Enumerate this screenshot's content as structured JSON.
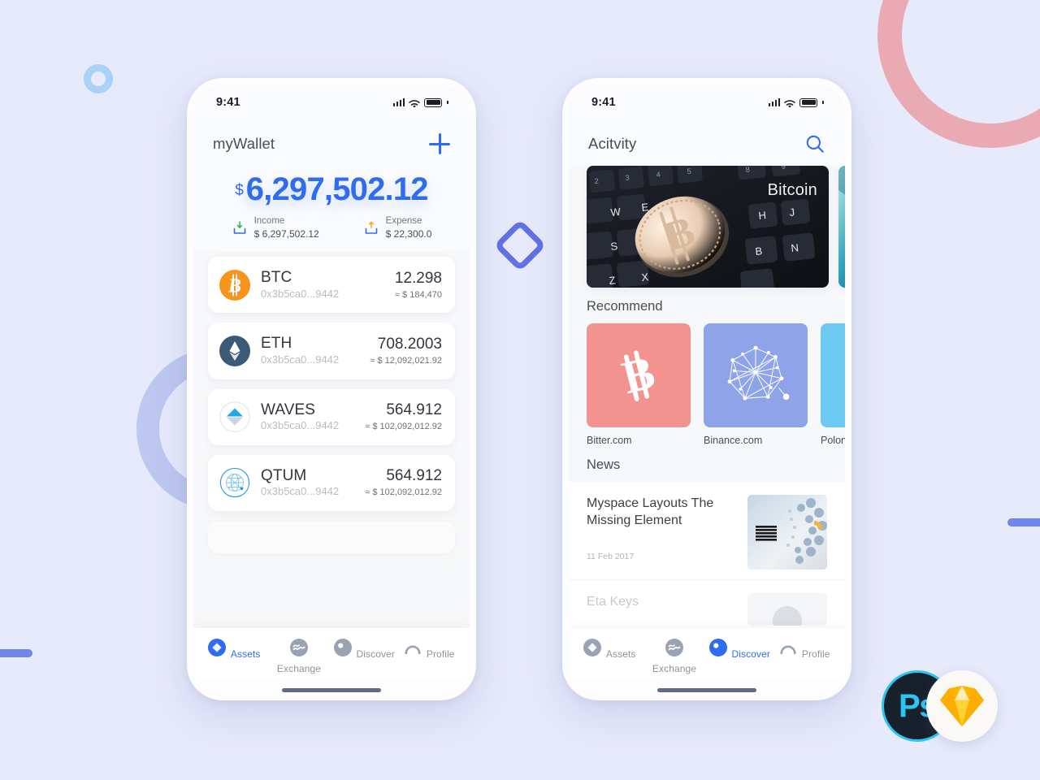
{
  "background": {
    "color": "#e7eafb",
    "decorations": [
      {
        "name": "pink-ring-arc",
        "color": "#e9a7b0"
      },
      {
        "name": "periwinkle-ring-arc",
        "color": "#b9c4ee"
      },
      {
        "name": "blue-ring",
        "color": "#a8d2f7"
      },
      {
        "name": "blue-bar-left",
        "color": "#6f86ea"
      },
      {
        "name": "blue-bar-right",
        "color": "#6f86ea"
      },
      {
        "name": "blue-diamond-outline",
        "color": "#6272e3"
      }
    ]
  },
  "accent": {
    "blue": "#2f6cf0",
    "muted": "#8e939c",
    "card": "#ffffff",
    "screen": "#f7f8f9"
  },
  "status_bar": {
    "time": "9:41",
    "signal_icon": "cellular-signal-icon",
    "wifi_icon": "wifi-icon",
    "battery_icon": "battery-full-icon"
  },
  "wallet": {
    "header": {
      "title": "myWallet",
      "add_icon": "plus-icon"
    },
    "balance": {
      "currency_symbol": "$",
      "amount": "6,297,502.12"
    },
    "summary": [
      {
        "icon": "income-download-icon",
        "label": "Income",
        "value": "$ 6,297,502.12"
      },
      {
        "icon": "expense-upload-icon",
        "label": "Expense",
        "value": "$ 22,300.0"
      }
    ],
    "assets": [
      {
        "icon": "bitcoin-coin-icon",
        "symbol": "BTC",
        "address": "0x3b5ca0...9442",
        "amount": "12.298",
        "fiat": "≈ $ 184,470",
        "color": "#f7941e"
      },
      {
        "icon": "ethereum-coin-icon",
        "symbol": "ETH",
        "address": "0x3b5ca0...9442",
        "amount": "708.2003",
        "fiat": "≈ $ 12,092,021.92",
        "color": "#3c5a78"
      },
      {
        "icon": "waves-coin-icon",
        "symbol": "WAVES",
        "address": "0x3b5ca0...9442",
        "amount": "564.912",
        "fiat": "≈ $ 102,092,012.92",
        "color": "#1eabdd"
      },
      {
        "icon": "qtum-coin-icon",
        "symbol": "QTUM",
        "address": "0x3b5ca0...9442",
        "amount": "564.912",
        "fiat": "≈ $ 102,092,012.92",
        "color": "#2e9ad0"
      }
    ],
    "tabs": [
      {
        "icon": "assets-diamond-icon",
        "label": "Assets",
        "active": true
      },
      {
        "icon": "exchange-waves-icon",
        "label": "Exchange",
        "active": false
      },
      {
        "icon": "discover-compass-icon",
        "label": "Discover",
        "active": false
      },
      {
        "icon": "profile-person-icon",
        "label": "Profile",
        "active": false
      }
    ]
  },
  "discover": {
    "header": {
      "title": "Acitvity",
      "search_icon": "search-icon"
    },
    "banners": [
      {
        "name": "bitcoin-keyboard-banner",
        "label": "Bitcoin"
      },
      {
        "name": "teal-abstract-banner",
        "label": ""
      }
    ],
    "recommend": {
      "title": "Recommend",
      "items": [
        {
          "icon": "bitcoin-b-icon",
          "name": "Bitter.com",
          "color": "#f29390"
        },
        {
          "icon": "binance-network-icon",
          "name": "Binance.com",
          "color": "#8fa3e8"
        },
        {
          "icon": "poloniex-icon",
          "name": "Polonie",
          "color": "#6ec9f2"
        }
      ]
    },
    "news": {
      "title": "News",
      "items": [
        {
          "title": "Myspace Layouts The Missing Element",
          "date": "11 Feb 2017",
          "thumb": "ibm-server-photo"
        },
        {
          "title": "Eta Keys",
          "date": "",
          "thumb": "person-avatar-photo"
        }
      ]
    },
    "tabs": [
      {
        "icon": "assets-diamond-icon",
        "label": "Assets",
        "active": false
      },
      {
        "icon": "exchange-waves-icon",
        "label": "Exchange",
        "active": false
      },
      {
        "icon": "discover-compass-icon",
        "label": "Discover",
        "active": true
      },
      {
        "icon": "profile-person-icon",
        "label": "Profile",
        "active": false
      }
    ]
  },
  "tools": [
    {
      "name": "photoshop-logo",
      "label": "Ps"
    },
    {
      "name": "sketch-logo",
      "label": ""
    }
  ]
}
